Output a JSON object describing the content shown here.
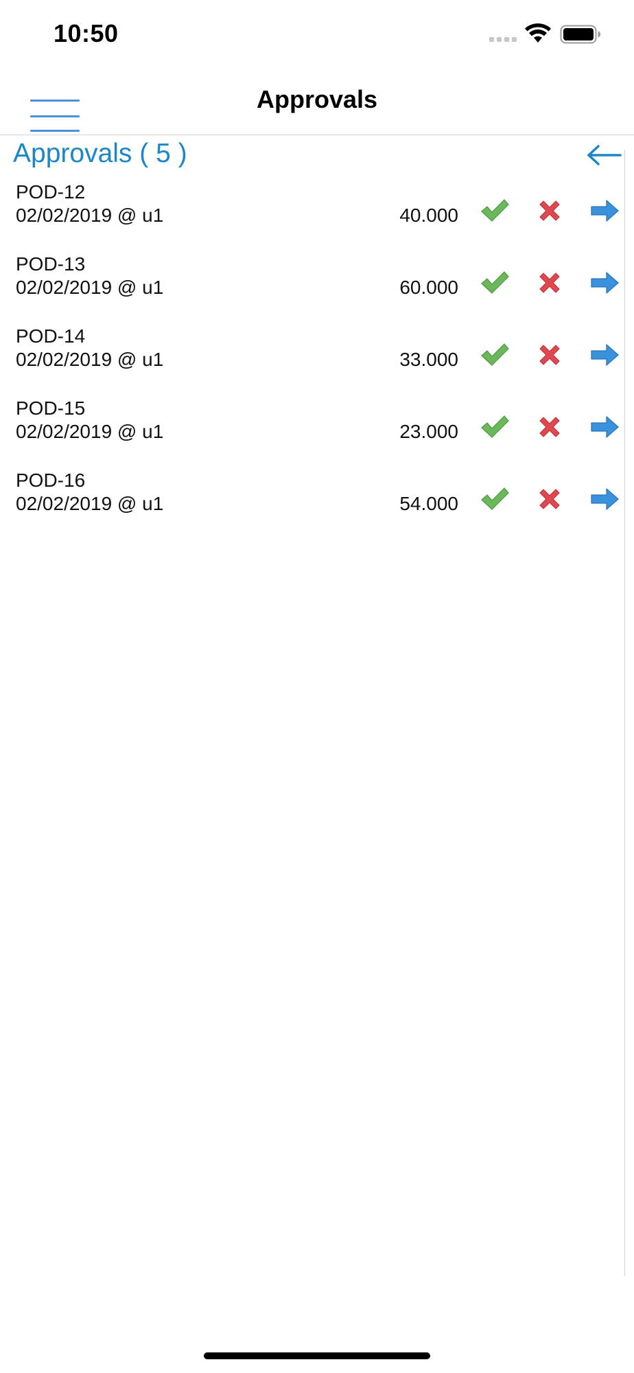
{
  "status_bar": {
    "time": "10:50",
    "signal_icon": "signal-dots-icon",
    "wifi_icon": "wifi-icon",
    "battery_icon": "battery-icon"
  },
  "nav": {
    "title": "Approvals",
    "menu_icon": "hamburger-menu-icon"
  },
  "section": {
    "title": "Approvals ( 5 )",
    "back_icon": "back-arrow-icon",
    "accent_color": "#1b86c8"
  },
  "approvals": [
    {
      "id": "POD-12",
      "meta": "02/02/2019 @ u1",
      "amount": "40.000"
    },
    {
      "id": "POD-13",
      "meta": "02/02/2019 @ u1",
      "amount": "60.000"
    },
    {
      "id": "POD-14",
      "meta": "02/02/2019 @ u1",
      "amount": "33.000"
    },
    {
      "id": "POD-15",
      "meta": "02/02/2019 @ u1",
      "amount": "23.000"
    },
    {
      "id": "POD-16",
      "meta": "02/02/2019 @ u1",
      "amount": "54.000"
    }
  ],
  "row_actions": {
    "approve_icon": "checkmark-icon",
    "reject_icon": "cross-icon",
    "open_icon": "forward-arrow-icon",
    "approve_color": "#6ab85a",
    "reject_color": "#e0484f",
    "open_color": "#3b92dc"
  }
}
